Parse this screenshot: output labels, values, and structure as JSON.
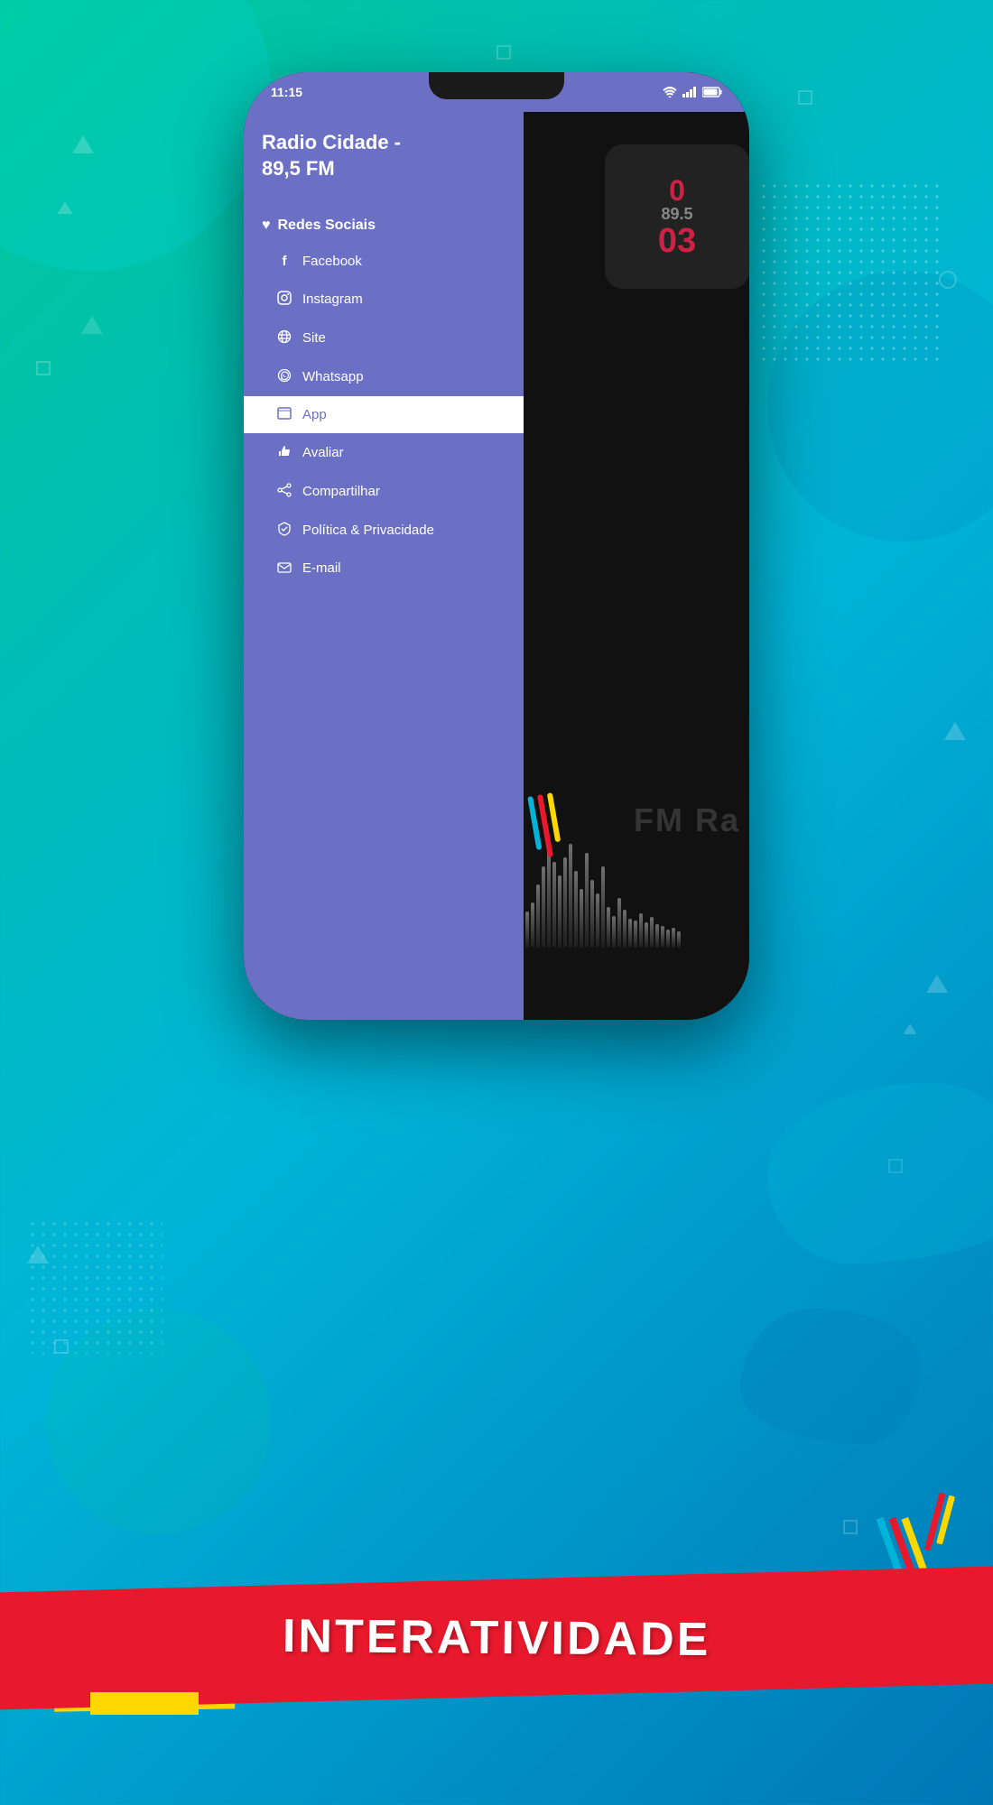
{
  "background": {
    "gradient_start": "#00c896",
    "gradient_end": "#0077b6"
  },
  "phone": {
    "status_bar": {
      "time": "11:15",
      "icons": [
        "📷",
        "🔋"
      ]
    },
    "app_title": "Radio Cidade -\n89,5 FM",
    "back_arrow": "←",
    "menu": {
      "section_label": "🖤 Redes Sociais",
      "section_icon": "♥",
      "items": [
        {
          "icon": "f",
          "label": "Facebook",
          "active": false
        },
        {
          "icon": "◎",
          "label": "Instagram",
          "active": false
        },
        {
          "icon": "🌐",
          "label": "Site",
          "active": false
        },
        {
          "icon": "◉",
          "label": "Whatsapp",
          "active": false
        },
        {
          "icon": "▭",
          "label": "App",
          "active": true
        },
        {
          "icon": "👍",
          "label": "Avaliar",
          "active": false
        },
        {
          "icon": "◈",
          "label": "Compartilhar",
          "active": false
        },
        {
          "icon": "◄",
          "label": "Política & Privacidade",
          "active": false
        },
        {
          "icon": "✉",
          "label": "E-mail",
          "active": false
        }
      ]
    },
    "radio": {
      "logo_top": "0",
      "logo_freq": "89.5",
      "logo_bottom": "03",
      "fm_ra_text": "FM Ra"
    }
  },
  "banner": {
    "text": "INTERATIVIDADE",
    "accent_color_red": "#e8192c",
    "accent_color_blue": "#00b4d8",
    "accent_color_yellow": "#ffd700"
  }
}
